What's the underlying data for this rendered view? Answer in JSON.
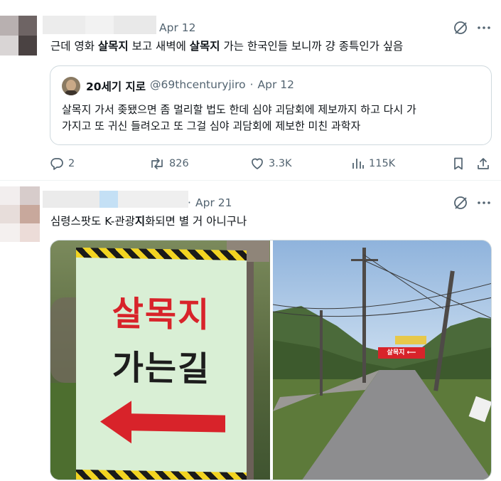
{
  "colors": {
    "text": "#0f1419",
    "muted": "#536471",
    "border": "#cfd9de",
    "sign_red": "#d8232a",
    "sign_bg": "#d9efd5"
  },
  "tweet1": {
    "date": "Apr 12",
    "text_segments": [
      {
        "t": "근데 영화 ",
        "b": false
      },
      {
        "t": "살목지",
        "b": true
      },
      {
        "t": " 보고 새벽에 ",
        "b": false
      },
      {
        "t": "살목지",
        "b": true
      },
      {
        "t": " 가는 한국인들 보니까 걍 종특인가 싶음",
        "b": false
      }
    ],
    "quote": {
      "name": "20세기 지로",
      "handle": "@69thcenturyjiro",
      "sep": "·",
      "date": "Apr 12",
      "line1": "살목지 가서 좆됐으면 좀 멀리할 법도 한데 심야 괴담회에 제보까지 하고 다시 가",
      "line2": "가지고 또 귀신 들려오고 또 그걸 심야 괴담회에 제보한 미친 과학자"
    },
    "stats": {
      "replies": "2",
      "reposts": "826",
      "likes": "3.3K",
      "views": "115K"
    },
    "icons": [
      "grok-icon",
      "more-icon",
      "reply-icon",
      "repost-icon",
      "like-icon",
      "views-icon",
      "bookmark-icon",
      "share-icon"
    ]
  },
  "tweet2": {
    "date": "Apr 21",
    "text_segments": [
      {
        "t": "심령스팟도 K-관광",
        "b": false
      },
      {
        "t": "지",
        "b": true
      },
      {
        "t": "화되면 별 거 아니구나",
        "b": false
      }
    ],
    "sign": {
      "line1": "살목지",
      "line2": "가는길"
    },
    "banner": {
      "text": "살목지 ⟵"
    }
  }
}
